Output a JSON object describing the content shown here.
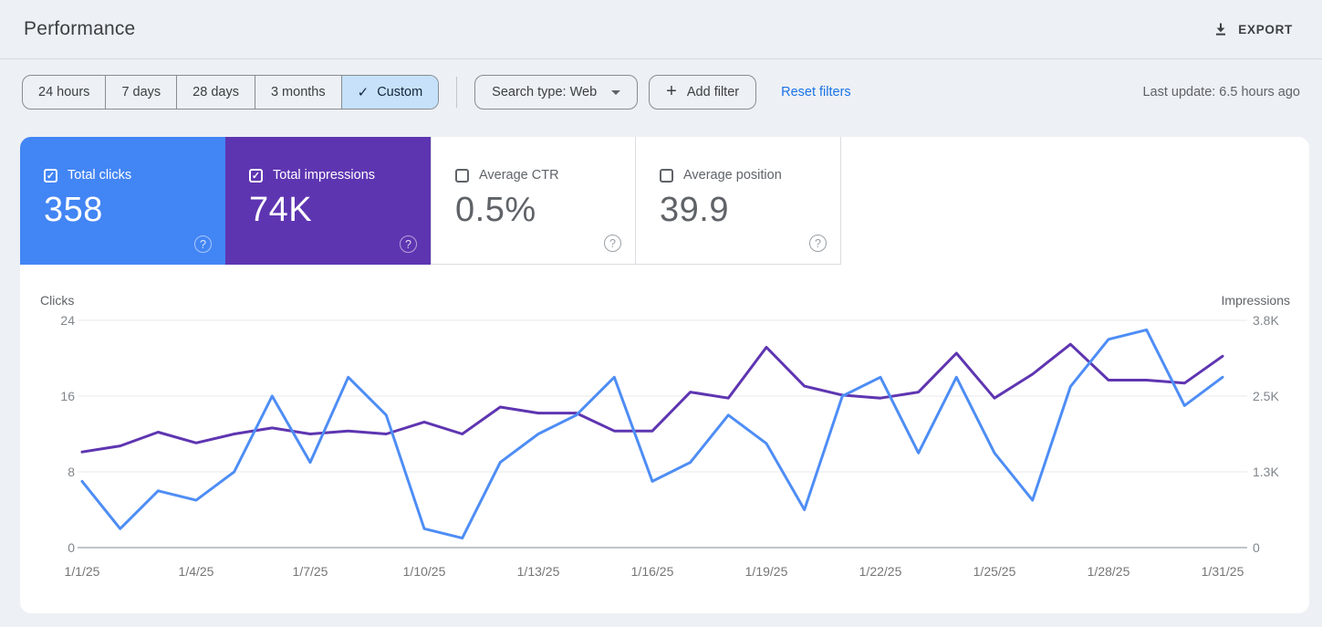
{
  "header": {
    "title": "Performance",
    "export_label": "EXPORT"
  },
  "filters": {
    "date_tabs": [
      {
        "label": "24 hours",
        "selected": false
      },
      {
        "label": "7 days",
        "selected": false
      },
      {
        "label": "28 days",
        "selected": false
      },
      {
        "label": "3 months",
        "selected": false
      },
      {
        "label": "Custom",
        "selected": true
      }
    ],
    "search_type_label": "Search type: Web",
    "add_filter_label": "Add filter",
    "reset_label": "Reset filters",
    "last_update": "Last update: 6.5 hours ago"
  },
  "metrics": [
    {
      "label": "Total clicks",
      "value": "358",
      "checked": true,
      "bg": "#4285f4"
    },
    {
      "label": "Total impressions",
      "value": "74K",
      "checked": true,
      "bg": "#5e35b1"
    },
    {
      "label": "Average CTR",
      "value": "0.5%",
      "checked": false,
      "bg": "#ffffff"
    },
    {
      "label": "Average position",
      "value": "39.9",
      "checked": false,
      "bg": "#ffffff"
    }
  ],
  "colors": {
    "clicks_blue": "#4285f4",
    "impressions_purple": "#5e35b1",
    "line_clicks": "#4e8df5",
    "line_impressions": "#5e35b1",
    "selected_tab_bg": "#c6e1f9",
    "link_blue": "#1a73e8"
  },
  "chart_data": {
    "type": "line",
    "x": [
      "1/1/25",
      "1/2/25",
      "1/3/25",
      "1/4/25",
      "1/5/25",
      "1/6/25",
      "1/7/25",
      "1/8/25",
      "1/9/25",
      "1/10/25",
      "1/11/25",
      "1/12/25",
      "1/13/25",
      "1/14/25",
      "1/15/25",
      "1/16/25",
      "1/17/25",
      "1/18/25",
      "1/19/25",
      "1/20/25",
      "1/21/25",
      "1/22/25",
      "1/23/25",
      "1/24/25",
      "1/25/25",
      "1/26/25",
      "1/27/25",
      "1/28/25",
      "1/29/25",
      "1/30/25",
      "1/31/25"
    ],
    "x_tick_every": 3,
    "series": [
      {
        "name": "Clicks",
        "axis": "left",
        "color": "#4e8df5",
        "values": [
          7,
          2,
          6,
          5,
          8,
          16,
          9,
          18,
          14,
          2,
          1,
          9,
          12,
          14,
          18,
          7,
          9,
          14,
          11,
          4,
          16,
          18,
          10,
          18,
          10,
          5,
          17,
          22,
          23,
          15,
          18
        ]
      },
      {
        "name": "Impressions",
        "axis": "right",
        "color": "#5e35b1",
        "values": [
          1600,
          1700,
          1930,
          1750,
          1900,
          2000,
          1900,
          1950,
          1900,
          2100,
          1900,
          2350,
          2250,
          2250,
          1950,
          1950,
          2600,
          2500,
          3350,
          2700,
          2550,
          2500,
          2600,
          3250,
          2500,
          2900,
          3400,
          2800,
          2800,
          2750,
          3200
        ]
      }
    ],
    "left_axis": {
      "label": "Clicks",
      "ticks": [
        "0",
        "8",
        "16",
        "24"
      ],
      "max": 24
    },
    "right_axis": {
      "label": "Impressions",
      "ticks": [
        "0",
        "1.3K",
        "2.5K",
        "3.8K"
      ],
      "max": 3800
    },
    "grid": true,
    "legend_position": "none"
  }
}
